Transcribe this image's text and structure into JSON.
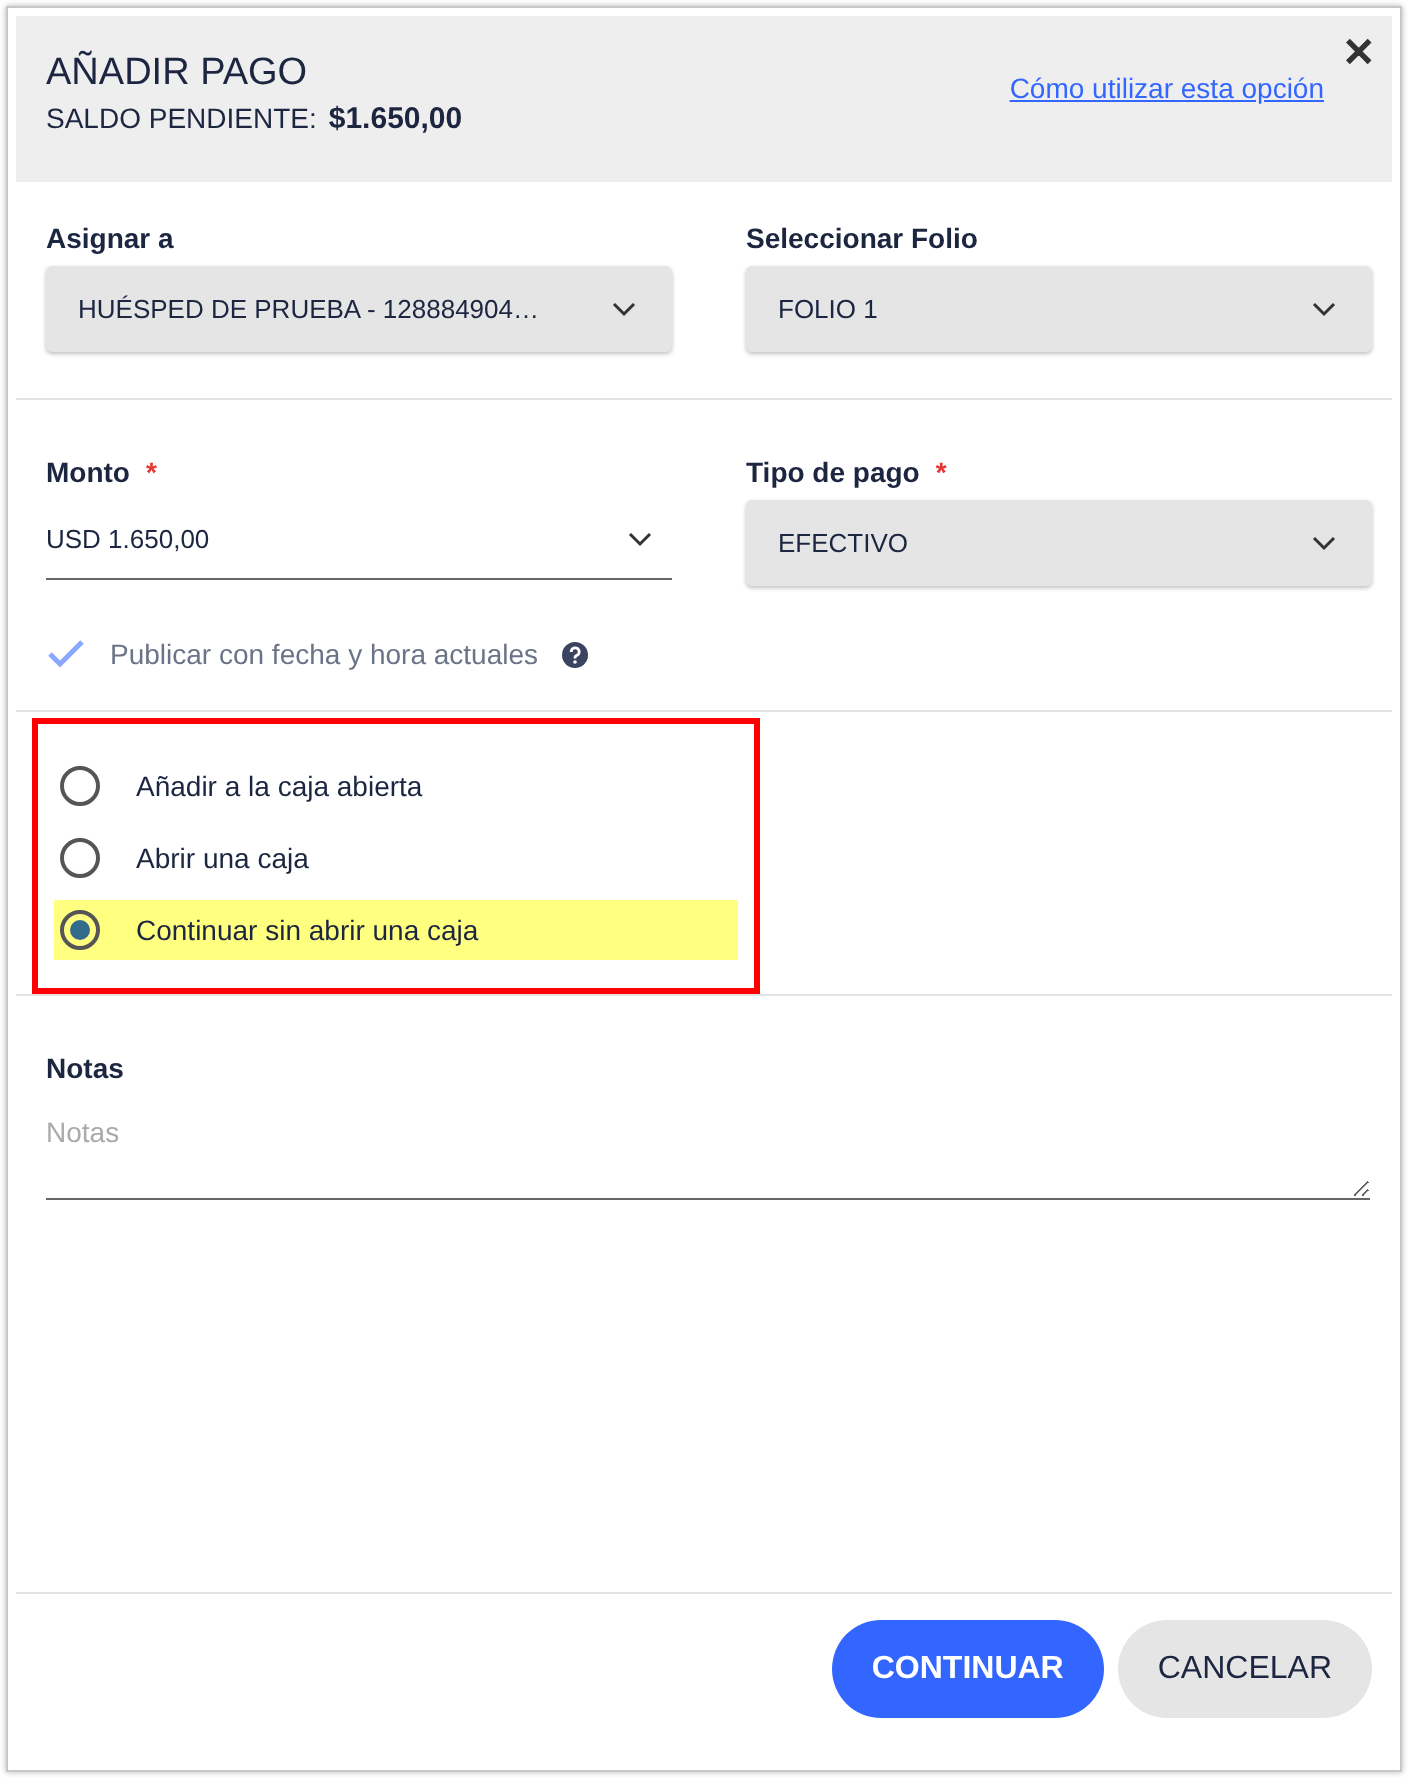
{
  "dialog": {
    "title": "AÑADIR PAGO",
    "balance_label": "SALDO PENDIENTE:",
    "balance_value": "$1.650,00",
    "help_link": "Cómo utilizar esta opción",
    "close": "✕"
  },
  "row_1": [
    {
      "label": "Asignar a",
      "value": "HUÉSPED DE PRUEBA - 128884904…",
      "kind": "select"
    },
    {
      "label": "Seleccionar Folio",
      "value": "FOLIO 1",
      "kind": "select"
    }
  ],
  "row_2": [
    {
      "label": "Monto",
      "required_mark": "*",
      "value": "USD 1.650,00",
      "kind": "underline"
    },
    {
      "label": "Tipo de pago",
      "required_mark": "*",
      "value": "EFECTIVO",
      "kind": "select"
    }
  ],
  "post_now": {
    "label": "Publicar con fecha y hora actuales",
    "checked": true
  },
  "cash_options": {
    "framed": true,
    "items": [
      {
        "label": "Añadir a la caja abierta",
        "selected": false,
        "highlighted": false
      },
      {
        "label": "Abrir una caja",
        "selected": false,
        "highlighted": false
      },
      {
        "label": "Continuar sin abrir una caja",
        "selected": true,
        "highlighted": true
      }
    ]
  },
  "notes": {
    "label": "Notas",
    "placeholder": "Notas"
  },
  "buttons": [
    {
      "label": "CONTINUAR",
      "kind": "primary"
    },
    {
      "label": "CANCELAR",
      "kind": "secondary"
    }
  ]
}
